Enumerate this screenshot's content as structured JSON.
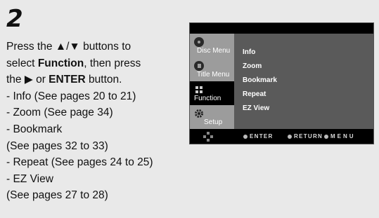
{
  "step": {
    "number": "2"
  },
  "instruction": {
    "line1": "Press the ▲/▼ buttons to",
    "line2_pre": "select ",
    "line2_bold": "Function",
    "line2_post": ", then press",
    "line3_pre": "the ▶ or ",
    "line3_bold": "ENTER",
    "line3_post": " button."
  },
  "list": [
    {
      "text": "- Info (See pages 20 to 21)"
    },
    {
      "text": "- Zoom (See page 34)"
    },
    {
      "text": "- Bookmark"
    },
    {
      "text": "(See pages 32 to 33)"
    },
    {
      "text": "- Repeat (See pages 24 to 25)"
    },
    {
      "text": "- EZ View"
    },
    {
      "text": "(See pages 27 to 28)"
    }
  ],
  "osd": {
    "tabs": [
      {
        "label": "Disc Menu",
        "icon": "disc-icon",
        "active": false
      },
      {
        "label": "Title Menu",
        "icon": "title-icon",
        "active": false
      },
      {
        "label": "Function",
        "icon": "function-icon",
        "active": true
      },
      {
        "label": "Setup",
        "icon": "gear-icon",
        "active": false
      }
    ],
    "menu_items": [
      "Info",
      "Zoom",
      "Bookmark",
      "Repeat",
      "EZ View"
    ],
    "hints": {
      "enter": "ENTER",
      "return": "RETURN",
      "menu": "MENU"
    }
  }
}
